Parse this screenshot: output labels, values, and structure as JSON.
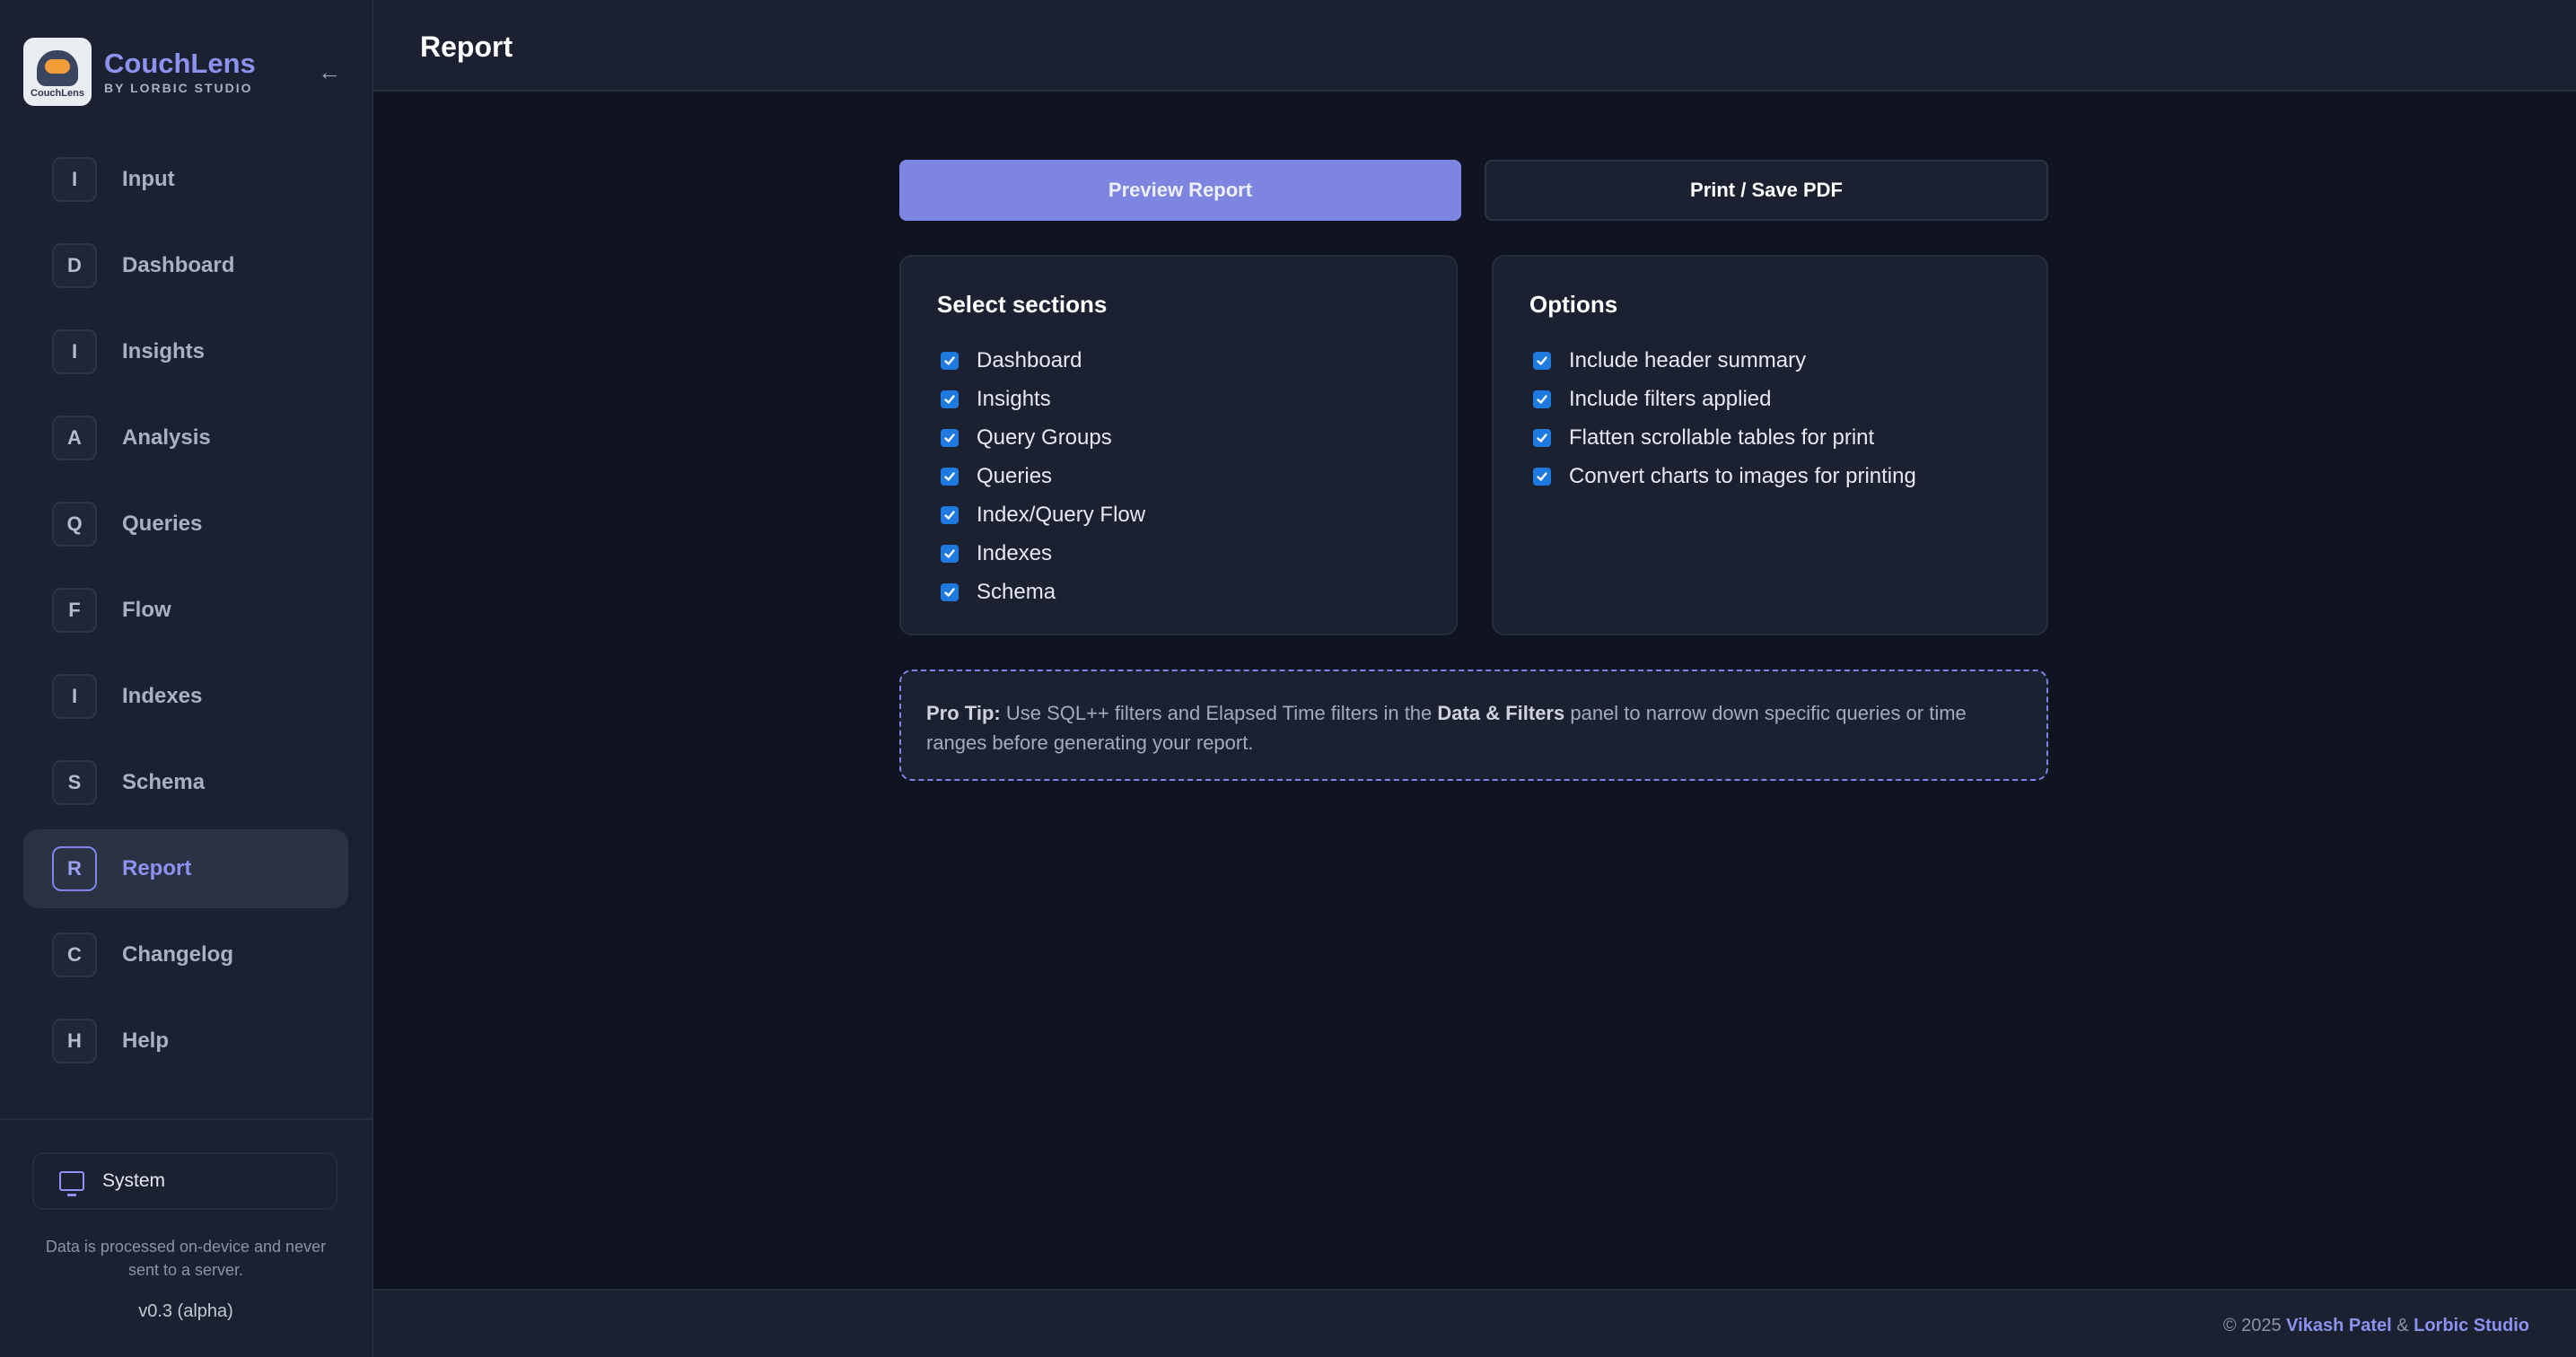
{
  "brand": {
    "name": "CouchLens",
    "subtitle": "BY LORBIC STUDIO",
    "logo_text": "CouchLens",
    "collapse_icon": "←"
  },
  "nav": {
    "items": [
      {
        "badge": "I",
        "label": "Input",
        "active": false
      },
      {
        "badge": "D",
        "label": "Dashboard",
        "active": false
      },
      {
        "badge": "I",
        "label": "Insights",
        "active": false
      },
      {
        "badge": "A",
        "label": "Analysis",
        "active": false
      },
      {
        "badge": "Q",
        "label": "Queries",
        "active": false
      },
      {
        "badge": "F",
        "label": "Flow",
        "active": false
      },
      {
        "badge": "I",
        "label": "Indexes",
        "active": false
      },
      {
        "badge": "S",
        "label": "Schema",
        "active": false
      },
      {
        "badge": "R",
        "label": "Report",
        "active": true
      },
      {
        "badge": "C",
        "label": "Changelog",
        "active": false
      },
      {
        "badge": "H",
        "label": "Help",
        "active": false
      }
    ]
  },
  "sidebar_footer": {
    "theme_label": "System",
    "privacy_note": "Data is processed on-device and never sent to a server.",
    "version": "v0.3 (alpha)"
  },
  "header": {
    "title": "Report"
  },
  "actions": {
    "preview_label": "Preview Report",
    "print_label": "Print / Save PDF"
  },
  "sections": {
    "title": "Select sections",
    "items": [
      {
        "label": "Dashboard",
        "checked": true
      },
      {
        "label": "Insights",
        "checked": true
      },
      {
        "label": "Query Groups",
        "checked": true
      },
      {
        "label": "Queries",
        "checked": true
      },
      {
        "label": "Index/Query Flow",
        "checked": true
      },
      {
        "label": "Indexes",
        "checked": true
      },
      {
        "label": "Schema",
        "checked": true
      }
    ]
  },
  "options": {
    "title": "Options",
    "items": [
      {
        "label": "Include header summary",
        "checked": true
      },
      {
        "label": "Include filters applied",
        "checked": true
      },
      {
        "label": "Flatten scrollable tables for print",
        "checked": true
      },
      {
        "label": "Convert charts to images for printing",
        "checked": true
      }
    ]
  },
  "tip": {
    "prefix": "Pro Tip:",
    "text_before": " Use SQL++ filters and Elapsed Time filters in the ",
    "highlight": "Data & Filters",
    "text_after": " panel to narrow down specific queries or time ranges before generating your report."
  },
  "footer": {
    "copyright_prefix": "© 2025 ",
    "author": "Vikash Patel",
    "separator": " & ",
    "studio": "Lorbic Studio"
  },
  "colors": {
    "accent": "#8b92f0",
    "checkbox": "#1f7ae0",
    "background": "#0f1420",
    "panel": "#1b2130"
  }
}
